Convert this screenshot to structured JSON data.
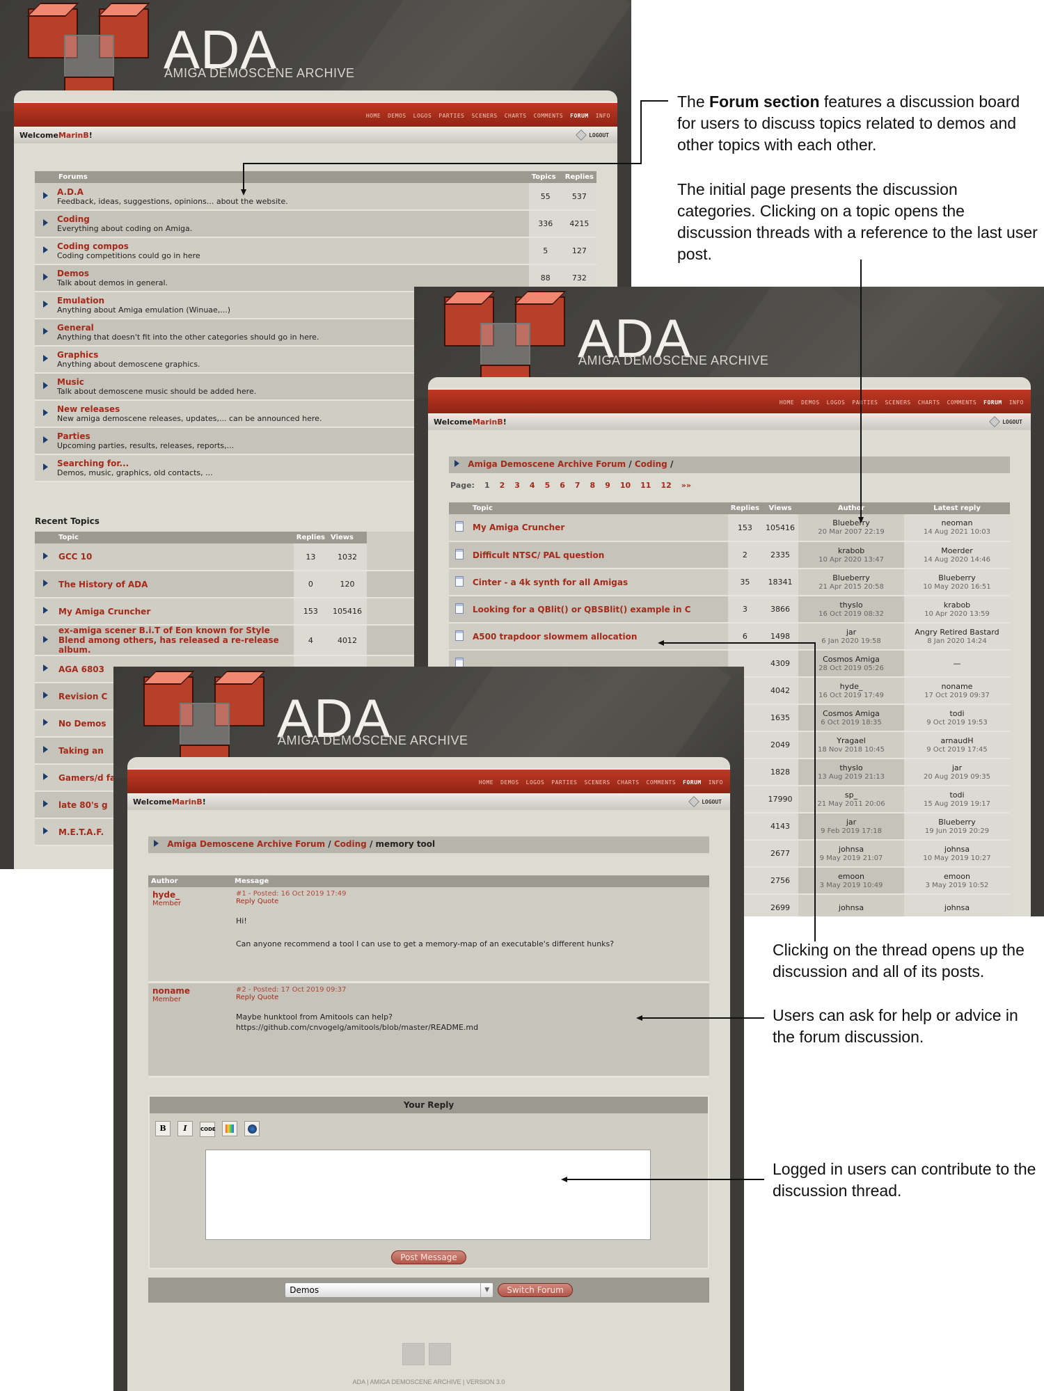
{
  "site": {
    "title": "ADA",
    "subtitle": "AMIGA DEMOSCENE ARCHIVE",
    "nav": [
      "HOME",
      "DEMOS",
      "LOGOS",
      "PARTIES",
      "SCENERS",
      "CHARTS",
      "COMMENTS",
      "FORUM",
      "INFO"
    ],
    "welcome_prefix": "Welcome ",
    "username": "MarinB",
    "welcome_suffix": "!",
    "logout": "LOGOUT",
    "footer": "ADA | AMIGA DEMOSCENE ARCHIVE | VERSION 3.0"
  },
  "forums": {
    "headers": {
      "forums": "Forums",
      "topics": "Topics",
      "replies": "Replies"
    },
    "rows": [
      {
        "name": "A.D.A",
        "desc": "Feedback, ideas, suggestions, opinions... about the website.",
        "topics": "55",
        "replies": "537"
      },
      {
        "name": "Coding",
        "desc": "Everything about coding on Amiga.",
        "topics": "336",
        "replies": "4215"
      },
      {
        "name": "Coding compos",
        "desc": "Coding competitions could go in here",
        "topics": "5",
        "replies": "127"
      },
      {
        "name": "Demos",
        "desc": "Talk about demos in general.",
        "topics": "88",
        "replies": "732"
      },
      {
        "name": "Emulation",
        "desc": "Anything about Amiga emulation (Winuae,...)",
        "topics": "",
        "replies": ""
      },
      {
        "name": "General",
        "desc": "Anything that doesn't fit into the other categories should go in here.",
        "topics": "",
        "replies": ""
      },
      {
        "name": "Graphics",
        "desc": "Anything about demoscene graphics.",
        "topics": "",
        "replies": ""
      },
      {
        "name": "Music",
        "desc": "Talk about demoscene music should be added here.",
        "topics": "",
        "replies": ""
      },
      {
        "name": "New releases",
        "desc": "New amiga demoscene releases, updates,... can be announced here.",
        "topics": "",
        "replies": ""
      },
      {
        "name": "Parties",
        "desc": "Upcoming parties, results, releases, reports,...",
        "topics": "",
        "replies": ""
      },
      {
        "name": "Searching for...",
        "desc": "Demos, music, graphics, old contacts, ...",
        "topics": "",
        "replies": ""
      }
    ],
    "recent_title": "Recent Topics",
    "recent_headers": {
      "topic": "Topic",
      "replies": "Replies",
      "views": "Views"
    },
    "recent": [
      {
        "name": "GCC 10",
        "replies": "13",
        "views": "1032"
      },
      {
        "name": "The History of ADA",
        "replies": "0",
        "views": "120"
      },
      {
        "name": "My Amiga Cruncher",
        "replies": "153",
        "views": "105416"
      },
      {
        "name": "ex-amiga scener B.i.T of Eon known for Style Blend among others, has released a re-release album.",
        "replies": "4",
        "views": "4012"
      },
      {
        "name": "AGA 6803",
        "replies": "",
        "views": ""
      },
      {
        "name": "Revision C",
        "replies": "",
        "views": ""
      },
      {
        "name": "No Demos",
        "replies": "",
        "views": ""
      },
      {
        "name": "Taking an",
        "replies": "",
        "views": ""
      },
      {
        "name": "Gamers/d famous in",
        "replies": "",
        "views": ""
      },
      {
        "name": "late 80's g",
        "replies": "",
        "views": ""
      },
      {
        "name": "M.E.T.A.F.",
        "replies": "",
        "views": ""
      }
    ]
  },
  "threads": {
    "breadcrumb": {
      "root": "Amiga Demoscene Archive Forum",
      "sep": "/",
      "section": "Coding",
      "end": "/"
    },
    "page_label": "Page:",
    "pages": [
      "1",
      "2",
      "3",
      "4",
      "5",
      "6",
      "7",
      "8",
      "9",
      "10",
      "11",
      "12",
      "»»"
    ],
    "headers": {
      "topic": "Topic",
      "replies": "Replies",
      "views": "Views",
      "author": "Author",
      "latest": "Latest reply"
    },
    "rows": [
      {
        "title": "My Amiga Cruncher",
        "replies": "153",
        "views": "105416",
        "author": "Blueberry",
        "adate": "20 Mar 2007 22:19",
        "latest": "neoman",
        "ldate": "14 Aug 2021 10:03"
      },
      {
        "title": "Difficult NTSC/ PAL question",
        "replies": "2",
        "views": "2335",
        "author": "krabob",
        "adate": "10 Apr 2020 13:47",
        "latest": "Moerder",
        "ldate": "14 Aug 2020 14:46"
      },
      {
        "title": "Cinter - a 4k synth for all Amigas",
        "replies": "35",
        "views": "18341",
        "author": "Blueberry",
        "adate": "21 Apr 2015 20:58",
        "latest": "Blueberry",
        "ldate": "10 May 2020 16:51"
      },
      {
        "title": "Looking for a QBlit() or QBSBlit() example in C",
        "replies": "3",
        "views": "3866",
        "author": "thyslo",
        "adate": "16 Oct 2019 08:32",
        "latest": "krabob",
        "ldate": "10 Apr 2020 13:59"
      },
      {
        "title": "A500 trapdoor slowmem allocation",
        "replies": "6",
        "views": "1498",
        "author": "jar",
        "adate": "6 Jan 2020 19:58",
        "latest": "Angry Retired Bastard",
        "ldate": "8 Jan 2020 14:24"
      },
      {
        "title": "",
        "replies": "",
        "views": "4309",
        "author": "Cosmos Amiga",
        "adate": "28 Oct 2019 05:26",
        "latest": "—",
        "ldate": ""
      },
      {
        "title": "",
        "replies": "",
        "views": "4042",
        "author": "hyde_",
        "adate": "16 Oct 2019 17:49",
        "latest": "noname",
        "ldate": "17 Oct 2019 09:37"
      },
      {
        "title": "",
        "replies": "",
        "views": "1635",
        "author": "Cosmos Amiga",
        "adate": "6 Oct 2019 18:35",
        "latest": "todi",
        "ldate": "9 Oct 2019 19:53"
      },
      {
        "title": "",
        "replies": "",
        "views": "2049",
        "author": "Yragael",
        "adate": "18 Nov 2018 10:45",
        "latest": "arnaudH",
        "ldate": "9 Oct 2019 17:45"
      },
      {
        "title": "",
        "replies": "",
        "views": "1828",
        "author": "thyslo",
        "adate": "13 Aug 2019 21:13",
        "latest": "jar",
        "ldate": "20 Aug 2019 09:35"
      },
      {
        "title": "",
        "replies": "",
        "views": "17990",
        "author": "sp_",
        "adate": "21 May 2011 20:06",
        "latest": "todi",
        "ldate": "15 Aug 2019 19:17"
      },
      {
        "title": "",
        "replies": "",
        "views": "4143",
        "author": "jar",
        "adate": "9 Feb 2019 17:18",
        "latest": "Blueberry",
        "ldate": "19 Jun 2019 20:29"
      },
      {
        "title": "",
        "replies": "",
        "views": "2677",
        "author": "johnsa",
        "adate": "9 May 2019 21:07",
        "latest": "johnsa",
        "ldate": "10 May 2019 10:27"
      },
      {
        "title": "",
        "replies": "",
        "views": "2756",
        "author": "emoon",
        "adate": "3 May 2019 10:49",
        "latest": "emoon",
        "ldate": "3 May 2019 10:52"
      },
      {
        "title": "",
        "replies": "",
        "views": "2699",
        "author": "johnsa",
        "adate": "",
        "latest": "johnsa",
        "ldate": ""
      }
    ]
  },
  "thread": {
    "breadcrumb": {
      "root": "Amiga Demoscene Archive Forum",
      "sep": "/",
      "section": "Coding",
      "sep2": "/",
      "current": "memory tool"
    },
    "headers": {
      "author": "Author",
      "message": "Message"
    },
    "posts": [
      {
        "author": "hyde_",
        "role": "Member",
        "meta": "#1 - Posted: 16 Oct 2019 17:49",
        "actions": "Reply Quote",
        "lines": [
          "Hi!",
          "Can anyone recommend a tool I can use to get a memory-map of an executable's different hunks?"
        ]
      },
      {
        "author": "noname",
        "role": "Member",
        "meta": "#2 - Posted: 17 Oct 2019 09:37",
        "actions": "Reply Quote",
        "lines": [
          "Maybe hunktool from Amitools can help?",
          "https://github.com/cnvogelg/amitools/blob/master/README.md"
        ]
      }
    ],
    "reply_title": "Your Reply",
    "toolbar": {
      "bold": "B",
      "italic": "I",
      "code": "CODE"
    },
    "post_button": "Post Message",
    "forum_select": "Demos",
    "switch_button": "Switch Forum"
  },
  "annotations": {
    "a1_pre": "The ",
    "a1_bold": "Forum section",
    "a1_post": " features a discussion board for users to discuss topics related to demos and other topics with each other.",
    "a2": "The initial page presents the discussion categories. Clicking on a topic opens the discussion threads with a reference to the last user post.",
    "a3": "Clicking on the thread opens up the discussion and all of its posts.",
    "a4": "Users can ask for help or advice in the forum discussion.",
    "a5": "Logged in users can contribute to the discussion thread."
  }
}
